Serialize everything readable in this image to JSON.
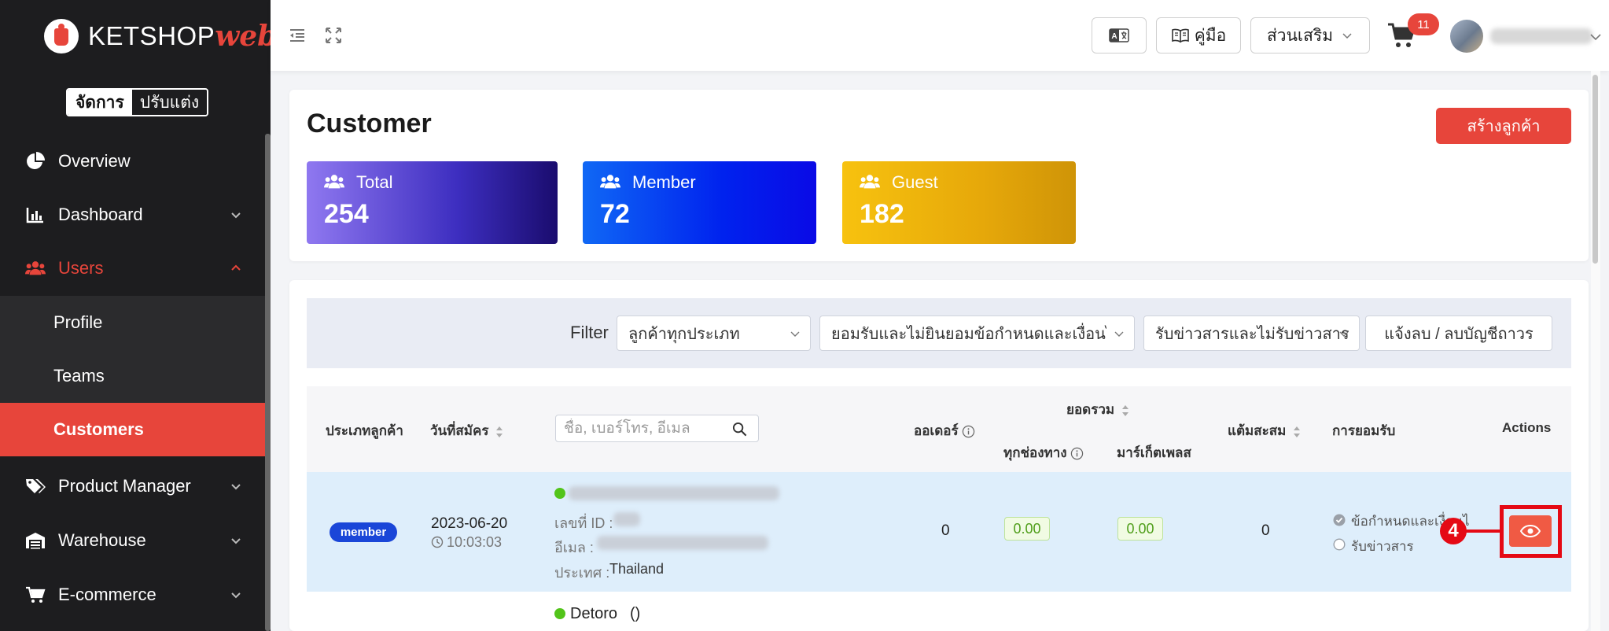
{
  "brand": {
    "name": "KETSHOP",
    "suffix": "web"
  },
  "mode_switch": {
    "manage": "จัดการ",
    "customize": "ปรับแต่ง"
  },
  "sidebar": {
    "items": [
      {
        "label": "Overview"
      },
      {
        "label": "Dashboard"
      },
      {
        "label": "Users"
      },
      {
        "label": "Product Manager"
      },
      {
        "label": "Warehouse"
      },
      {
        "label": "E-commerce"
      }
    ],
    "users_sub": [
      {
        "label": "Profile"
      },
      {
        "label": "Teams"
      },
      {
        "label": "Customers"
      }
    ]
  },
  "topbar": {
    "manual_label": "คู่มือ",
    "addons_label": "ส่วนเสริม",
    "cart_count": "11"
  },
  "page": {
    "title": "Customer",
    "create_button": "สร้างลูกค้า"
  },
  "stats": [
    {
      "label": "Total",
      "value": "254"
    },
    {
      "label": "Member",
      "value": "72"
    },
    {
      "label": "Guest",
      "value": "182"
    }
  ],
  "filter": {
    "label": "Filter",
    "customer_type": "ลูกค้าทุกประเภท",
    "consent": "ยอมรับและไม่ยินยอมข้อกำหนดและเงื่อนไข",
    "newsletter": "รับข่าวสารและไม่รับข่าวสาร",
    "delete_button": "แจ้งลบ / ลบบัญชีถาวร"
  },
  "table": {
    "headers": {
      "customer_type": "ประเภทลูกค้า",
      "signup_date": "วันที่สมัคร",
      "search_placeholder": "ชื่อ, เบอร์โทร, อีเมล",
      "orders": "ออเดอร์",
      "total": "ยอดรวม",
      "all_channels": "ทุกช่องทาง",
      "marketplace": "มาร์เก็ตเพลส",
      "points": "แต้มสะสม",
      "consent": "การยอมรับ",
      "actions": "Actions"
    },
    "rows": [
      {
        "type": "member",
        "date": "2023-06-20",
        "time": "10:03:03",
        "id_label": "เลขที่ ID :",
        "email_label": "อีเมล :",
        "country_label": "ประเทศ :",
        "country": "Thailand",
        "orders": "0",
        "all_channels": "0.00",
        "marketplace": "0.00",
        "points": "0",
        "terms": "ข้อกำหนดและเงื่อนไข",
        "newsletter": "รับข่าวสาร"
      },
      {
        "name": "Detoro",
        "extra": "()"
      }
    ]
  },
  "annotation": {
    "step": "4"
  },
  "colors": {
    "accent": "#e7453b",
    "sidebar_bg": "#1d1d1f",
    "member_badge": "#1a46d8",
    "row_highlight": "#deeefb",
    "online": "#52c41a"
  }
}
